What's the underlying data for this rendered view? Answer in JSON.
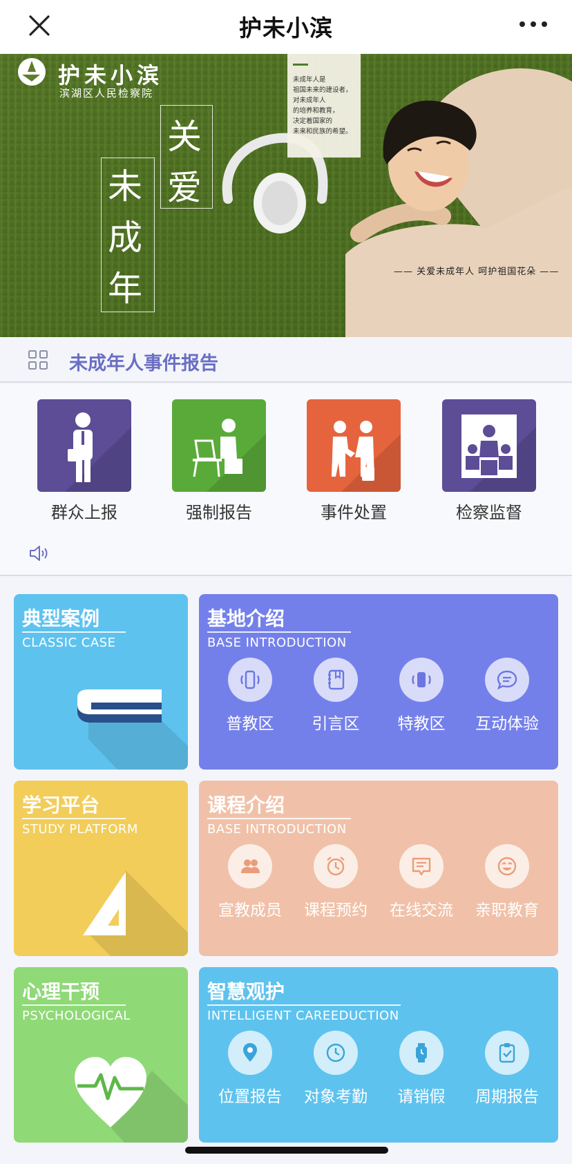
{
  "navbar": {
    "title": "护未小滨",
    "close_icon": "close-icon",
    "more_icon": "more-icon"
  },
  "banner": {
    "logo_name": "护未小滨",
    "logo_sub": "滨湖区人民检察院",
    "slogan_chars": [
      "关",
      "爱",
      "未",
      "成",
      "年"
    ],
    "card_text": "未成年人是\n祖国未来的建设者，\n对未成年人\n的培养和教育，\n决定着国家的\n未来和民族的希望。",
    "caption": "—— 关爱未成年人   呵护祖国花朵 ——"
  },
  "report": {
    "title": "未成年人事件报告",
    "items": [
      {
        "label": "群众上报",
        "color": "#5c4d96",
        "icon": "citizen-icon"
      },
      {
        "label": "强制报告",
        "color": "#5aaa3a",
        "icon": "desk-worker-icon"
      },
      {
        "label": "事件处置",
        "color": "#e5643e",
        "icon": "handshake-icon"
      },
      {
        "label": "检察监督",
        "color": "#5c4d96",
        "icon": "court-icon"
      }
    ]
  },
  "cards": {
    "classic": {
      "title": "典型案例",
      "sub": "CLASSIC CASE",
      "color": "#5ec2ee"
    },
    "study": {
      "title": "学习平台",
      "sub": "STUDY PLATFORM",
      "color": "#f2cd5a"
    },
    "psych": {
      "title": "心理干预",
      "sub": "PSYCHOLOGICAL",
      "color": "#8fd977"
    },
    "base": {
      "title": "基地介绍",
      "sub": "BASE INTRODUCTION",
      "color": "#7480ea",
      "items": [
        "普教区",
        "引言区",
        "特教区",
        "互动体验"
      ]
    },
    "course": {
      "title": "课程介绍",
      "sub": "BASE INTRODUCTION",
      "color": "#f0c1a8",
      "items": [
        "宣教成员",
        "课程预约",
        "在线交流",
        "亲职教育"
      ]
    },
    "smart": {
      "title": "智慧观护",
      "sub": "INTELLIGENT CAREEDUCTION",
      "color": "#5ec2ee",
      "items": [
        "位置报告",
        "对象考勤",
        "请销假",
        "周期报告"
      ]
    }
  }
}
